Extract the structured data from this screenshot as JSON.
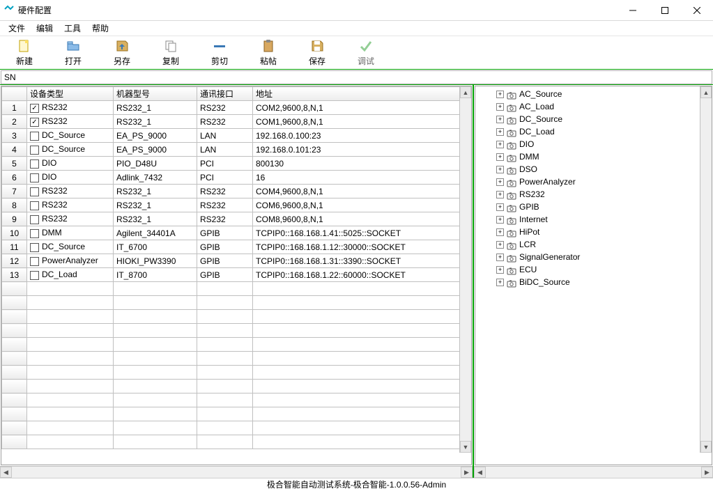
{
  "window": {
    "title": "硬件配置"
  },
  "menu": {
    "file": "文件",
    "edit": "编辑",
    "tools": "工具",
    "help": "帮助"
  },
  "toolbar": {
    "new": "新建",
    "open": "打开",
    "saveas": "另存",
    "copy": "复制",
    "cut": "剪切",
    "paste": "粘帖",
    "save": "保存",
    "debug": "调试"
  },
  "snlabel": "SN",
  "table": {
    "headers": {
      "rownum": "",
      "type": "设备类型",
      "model": "机器型号",
      "port": "通讯接口",
      "addr": "地址"
    },
    "rows": [
      {
        "n": "1",
        "chk": true,
        "type": "RS232",
        "model": "RS232_1",
        "port": "RS232",
        "addr": "COM2,9600,8,N,1"
      },
      {
        "n": "2",
        "chk": true,
        "type": "RS232",
        "model": "RS232_1",
        "port": "RS232",
        "addr": "COM1,9600,8,N,1"
      },
      {
        "n": "3",
        "chk": false,
        "type": "DC_Source",
        "model": "EA_PS_9000",
        "port": "LAN",
        "addr": "192.168.0.100:23"
      },
      {
        "n": "4",
        "chk": false,
        "type": "DC_Source",
        "model": "EA_PS_9000",
        "port": "LAN",
        "addr": "192.168.0.101:23"
      },
      {
        "n": "5",
        "chk": false,
        "type": "DIO",
        "model": "PIO_D48U",
        "port": "PCI",
        "addr": "800130"
      },
      {
        "n": "6",
        "chk": false,
        "type": "DIO",
        "model": "Adlink_7432",
        "port": "PCI",
        "addr": "16"
      },
      {
        "n": "7",
        "chk": false,
        "type": "RS232",
        "model": "RS232_1",
        "port": "RS232",
        "addr": "COM4,9600,8,N,1"
      },
      {
        "n": "8",
        "chk": false,
        "type": "RS232",
        "model": "RS232_1",
        "port": "RS232",
        "addr": "COM6,9600,8,N,1"
      },
      {
        "n": "9",
        "chk": false,
        "type": "RS232",
        "model": "RS232_1",
        "port": "RS232",
        "addr": "COM8,9600,8,N,1"
      },
      {
        "n": "10",
        "chk": false,
        "type": "DMM",
        "model": "Agilent_34401A",
        "port": "GPIB",
        "addr": "TCPIP0::168.168.1.41::5025::SOCKET"
      },
      {
        "n": "11",
        "chk": false,
        "type": "DC_Source",
        "model": "IT_6700",
        "port": "GPIB",
        "addr": "TCPIP0::168.168.1.12::30000::SOCKET"
      },
      {
        "n": "12",
        "chk": false,
        "type": "PowerAnalyzer",
        "model": "HIOKI_PW3390",
        "port": "GPIB",
        "addr": "TCPIP0::168.168.1.31::3390::SOCKET"
      },
      {
        "n": "13",
        "chk": false,
        "type": "DC_Load",
        "model": "IT_8700",
        "port": "GPIB",
        "addr": "TCPIP0::168.168.1.22::60000::SOCKET"
      }
    ],
    "emptyrows": 12
  },
  "tree": {
    "items": [
      "AC_Source",
      "AC_Load",
      "DC_Source",
      "DC_Load",
      "DIO",
      "DMM",
      "DSO",
      "PowerAnalyzer",
      "RS232",
      "GPIB",
      "Internet",
      "HiPot",
      "LCR",
      "SignalGenerator",
      "ECU",
      "BiDC_Source"
    ]
  },
  "status": "极合智能自动测试系统-极合智能-1.0.0.56-Admin"
}
